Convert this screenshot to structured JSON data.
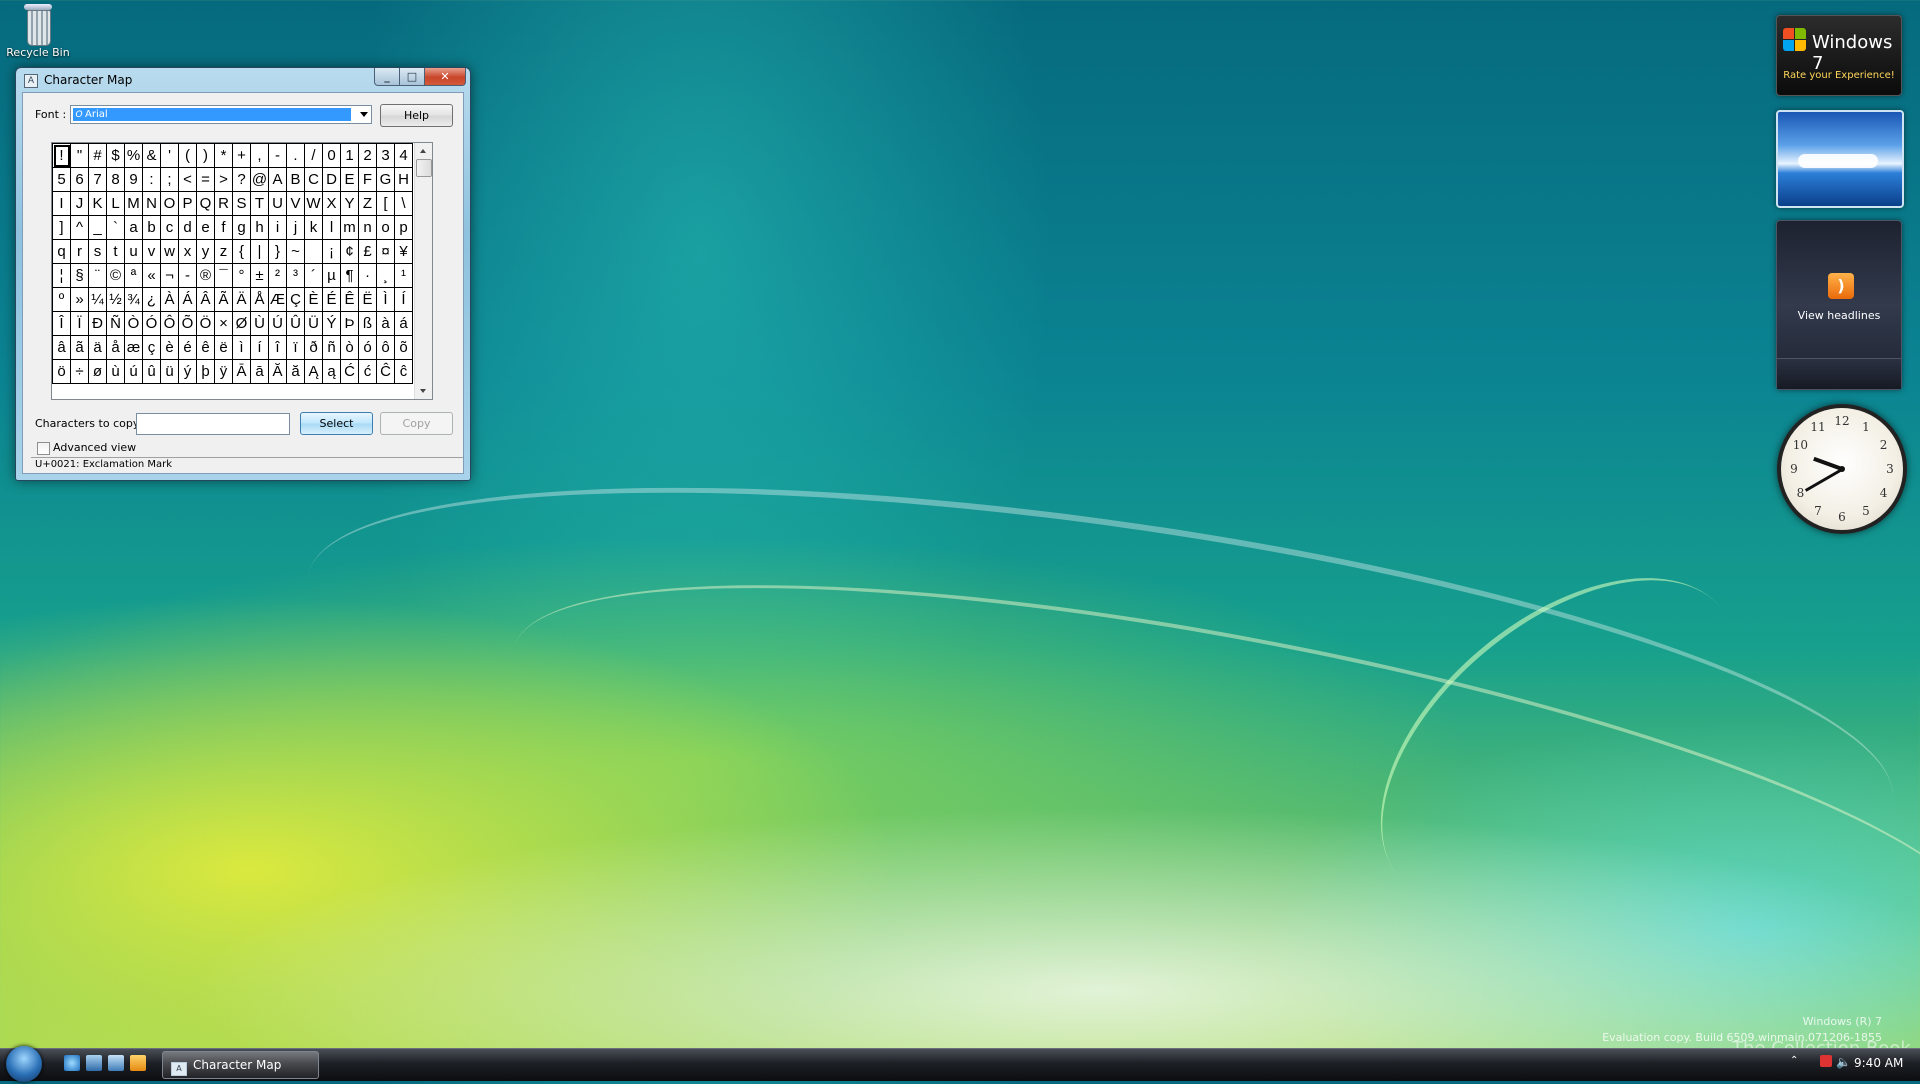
{
  "desktop": {
    "recycle_bin_label": "Recycle Bin",
    "watermark_line1": "Windows (R) 7",
    "watermark_line2": "Evaluation copy. Build 6509.winmain.071206-1855",
    "watermark_overlay": "The Collection Book"
  },
  "window": {
    "title": "Character Map",
    "font_label": "Font :",
    "font_value": "Arial",
    "help_label": "Help",
    "characters_to_copy_label": "Characters to copy",
    "characters_to_copy_value": "",
    "select_label": "Select",
    "copy_label": "Copy",
    "advanced_view_label": "Advanced view",
    "advanced_view_checked": false,
    "status_text": "U+0021: Exclamation Mark",
    "selected_index": 0,
    "grid_rows": [
      [
        "!",
        "\"",
        "#",
        "$",
        "%",
        "&",
        "'",
        "(",
        ")",
        "*",
        "+",
        ",",
        "-",
        ".",
        "/",
        "0",
        "1",
        "2",
        "3",
        "4"
      ],
      [
        "5",
        "6",
        "7",
        "8",
        "9",
        ":",
        ";",
        "<",
        "=",
        ">",
        "?",
        "@",
        "A",
        "B",
        "C",
        "D",
        "E",
        "F",
        "G",
        "H"
      ],
      [
        "I",
        "J",
        "K",
        "L",
        "M",
        "N",
        "O",
        "P",
        "Q",
        "R",
        "S",
        "T",
        "U",
        "V",
        "W",
        "X",
        "Y",
        "Z",
        "[",
        "\\"
      ],
      [
        "]",
        "^",
        "_",
        "`",
        "a",
        "b",
        "c",
        "d",
        "e",
        "f",
        "g",
        "h",
        "i",
        "j",
        "k",
        "l",
        "m",
        "n",
        "o",
        "p"
      ],
      [
        "q",
        "r",
        "s",
        "t",
        "u",
        "v",
        "w",
        "x",
        "y",
        "z",
        "{",
        "|",
        "}",
        "~",
        " ",
        "¡",
        "¢",
        "£",
        "¤",
        "¥"
      ],
      [
        "¦",
        "§",
        "¨",
        "©",
        "ª",
        "«",
        "¬",
        "-",
        "®",
        "¯",
        "°",
        "±",
        "²",
        "³",
        "´",
        "µ",
        "¶",
        "·",
        "¸",
        "¹"
      ],
      [
        "º",
        "»",
        "¼",
        "½",
        "¾",
        "¿",
        "À",
        "Á",
        "Â",
        "Ã",
        "Ä",
        "Å",
        "Æ",
        "Ç",
        "È",
        "É",
        "Ê",
        "Ë",
        "Ì",
        "Í"
      ],
      [
        "Î",
        "Ï",
        "Ð",
        "Ñ",
        "Ò",
        "Ó",
        "Ô",
        "Õ",
        "Ö",
        "×",
        "Ø",
        "Ù",
        "Ú",
        "Û",
        "Ü",
        "Ý",
        "Þ",
        "ß",
        "à",
        "á"
      ],
      [
        "â",
        "ã",
        "ä",
        "å",
        "æ",
        "ç",
        "è",
        "é",
        "ê",
        "ë",
        "ì",
        "í",
        "î",
        "ï",
        "ð",
        "ñ",
        "ò",
        "ó",
        "ô",
        "õ"
      ],
      [
        "ö",
        "÷",
        "ø",
        "ù",
        "ú",
        "û",
        "ü",
        "ý",
        "þ",
        "ÿ",
        "Ā",
        "ā",
        "Ă",
        "ă",
        "Ą",
        "ą",
        "Ć",
        "ć",
        "Ĉ",
        "ĉ"
      ]
    ]
  },
  "gadgets": {
    "win7_title": "Windows 7",
    "win7_subtitle": "Rate your Experience!",
    "feed_label": "View headlines",
    "feed_icon": "rss-icon",
    "clock_numerals": [
      "12",
      "1",
      "2",
      "3",
      "4",
      "5",
      "6",
      "7",
      "8",
      "9",
      "10",
      "11"
    ],
    "clock_time": {
      "hour": 9,
      "minute": 40
    }
  },
  "taskbar": {
    "task_label": "Character Map",
    "clock": "9:40 AM",
    "quick_launch": [
      "internet-explorer-icon",
      "show-desktop-icon",
      "switch-windows-icon",
      "media-player-icon"
    ]
  },
  "colors": {
    "selection": "#3399ff",
    "title_accent": "#ffd65a",
    "close_button": "#c8452a"
  }
}
